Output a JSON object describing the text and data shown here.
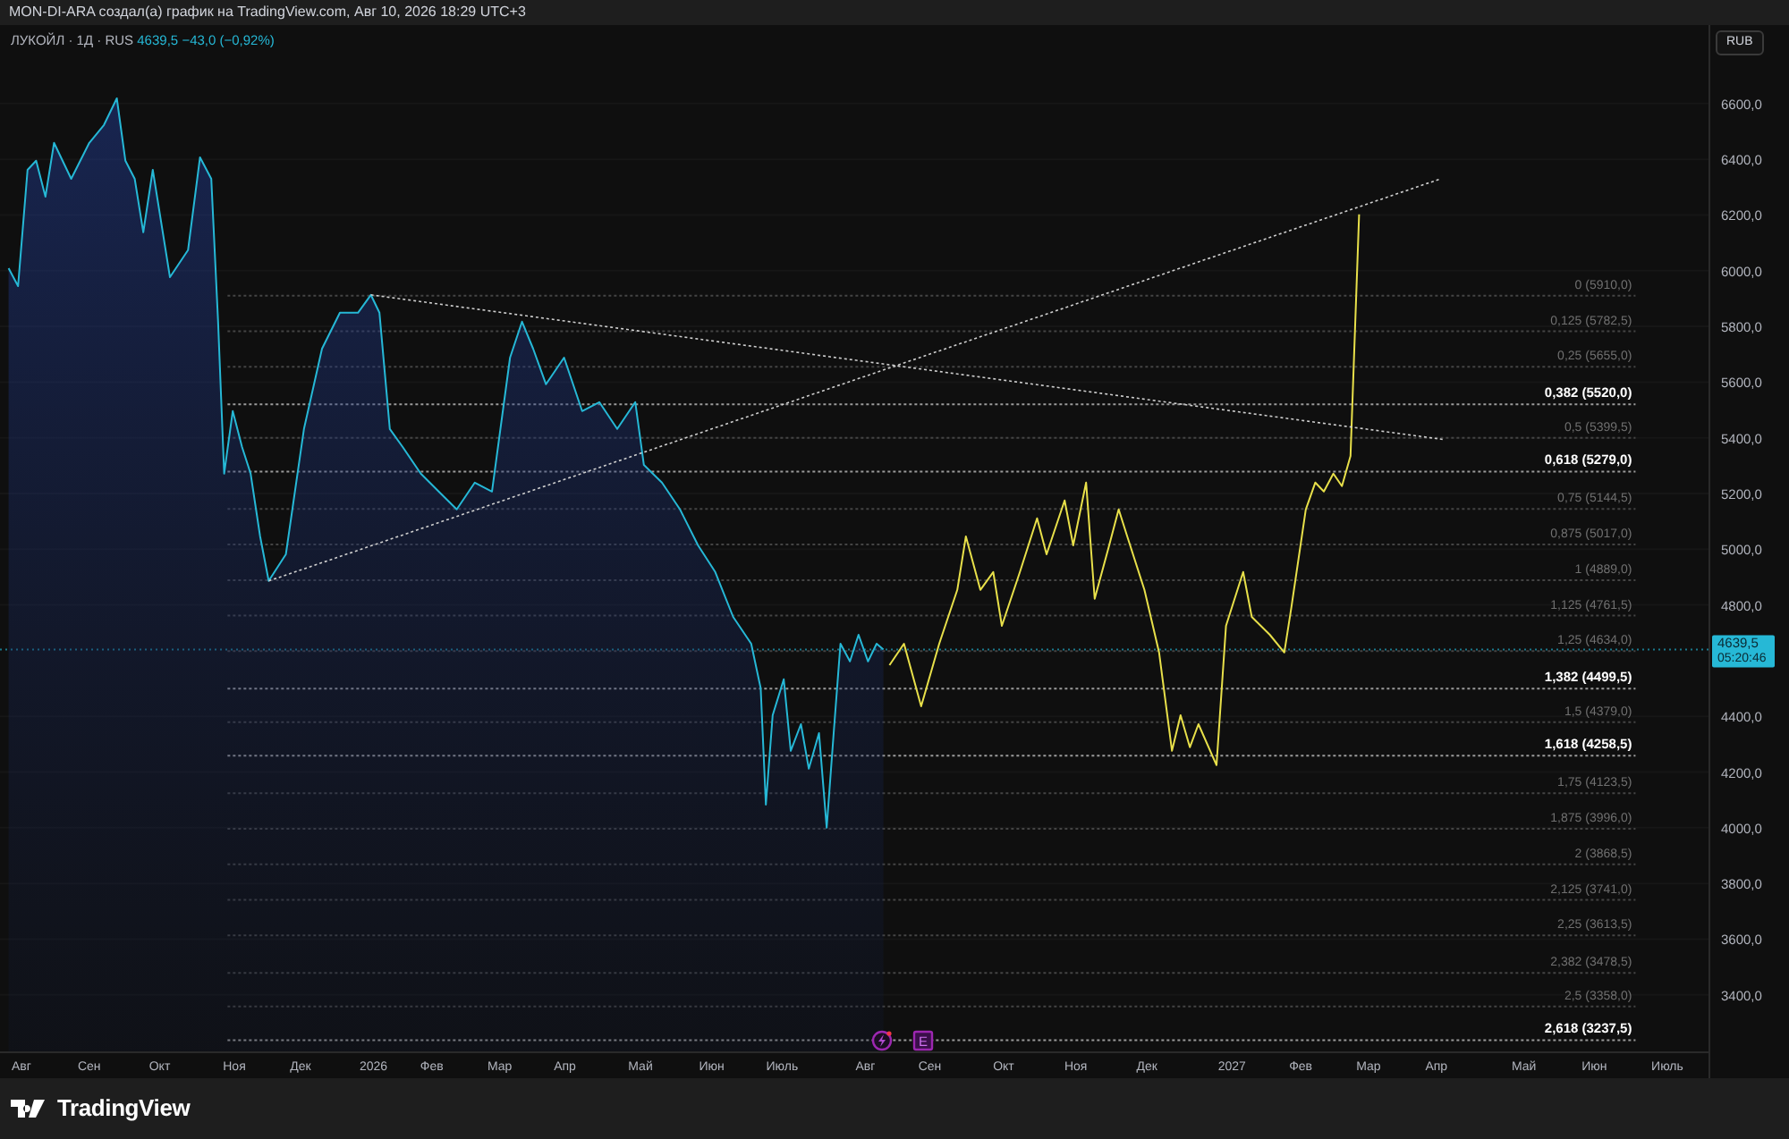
{
  "header": {
    "text": "MON-DI-ARA создал(а) график на TradingView.com, Авг 10, 2026 18:29 UTC+3"
  },
  "legend": {
    "symbol": "ЛУКОЙЛ · 1Д · RUS",
    "price": "4639,5",
    "change": "−43,0 (−0,92%)"
  },
  "currency_button": "RUB",
  "price_badge": {
    "price": "4639,5",
    "countdown": "05:20:46"
  },
  "events": [
    {
      "kind": "dividend"
    },
    {
      "kind": "earnings",
      "label": "E"
    }
  ],
  "chart_data": {
    "type": "line",
    "xlim": [
      2025.565,
      2027.555
    ],
    "ylim": [
      3197,
      6882
    ],
    "yticks": [
      {
        "value": 3400,
        "label": "3400,0"
      },
      {
        "value": 3600,
        "label": "3600,0"
      },
      {
        "value": 3800,
        "label": "3800,0"
      },
      {
        "value": 4000,
        "label": "4000,0"
      },
      {
        "value": 4200,
        "label": "4200,0"
      },
      {
        "value": 4400,
        "label": "4400,0"
      },
      {
        "value": 4800,
        "label": "4800,0"
      },
      {
        "value": 5000,
        "label": "5000,0"
      },
      {
        "value": 5200,
        "label": "5200,0"
      },
      {
        "value": 5400,
        "label": "5400,0"
      },
      {
        "value": 5600,
        "label": "5600,0"
      },
      {
        "value": 5800,
        "label": "5800,0"
      },
      {
        "value": 6000,
        "label": "6000,0"
      },
      {
        "value": 6200,
        "label": "6200,0"
      },
      {
        "value": 6400,
        "label": "6400,0"
      },
      {
        "value": 6600,
        "label": "6600,0"
      }
    ],
    "xticks": [
      {
        "value": 2025.59,
        "label": "Авг"
      },
      {
        "value": 2025.669,
        "label": "Сен"
      },
      {
        "value": 2025.751,
        "label": "Окт"
      },
      {
        "value": 2025.838,
        "label": "Ноя"
      },
      {
        "value": 2025.915,
        "label": "Дек"
      },
      {
        "value": 2026,
        "label": "2026"
      },
      {
        "value": 2026.068,
        "label": "Фев"
      },
      {
        "value": 2026.147,
        "label": "Мар"
      },
      {
        "value": 2026.223,
        "label": "Апр"
      },
      {
        "value": 2026.311,
        "label": "Май"
      },
      {
        "value": 2026.394,
        "label": "Июн"
      },
      {
        "value": 2026.476,
        "label": "Июль"
      },
      {
        "value": 2026.573,
        "label": "Авг"
      },
      {
        "value": 2026.648,
        "label": "Сен"
      },
      {
        "value": 2026.734,
        "label": "Окт"
      },
      {
        "value": 2026.818,
        "label": "Ноя"
      },
      {
        "value": 2026.901,
        "label": "Дек"
      },
      {
        "value": 2027,
        "label": "2027"
      },
      {
        "value": 2027.08,
        "label": "Фев"
      },
      {
        "value": 2027.159,
        "label": "Мар"
      },
      {
        "value": 2027.238,
        "label": "Апр"
      },
      {
        "value": 2027.34,
        "label": "Май"
      },
      {
        "value": 2027.422,
        "label": "Июн"
      },
      {
        "value": 2027.507,
        "label": "Июль"
      }
    ],
    "series": [
      {
        "color": "#26b8d6",
        "x": [
          2025.575,
          2025.586,
          2025.597,
          2025.607,
          2025.618,
          2025.628,
          2025.648,
          2025.669,
          2025.686,
          2025.701,
          2025.711,
          2025.722,
          2025.732,
          2025.743,
          2025.763,
          2025.784,
          2025.798,
          2025.811,
          2025.819,
          2025.826,
          2025.836,
          2025.847,
          2025.857,
          2025.868,
          2025.878,
          2025.898,
          2025.919,
          2025.94,
          2025.961,
          2025.982,
          2025.997,
          2026.007,
          2026.019,
          2026.034,
          2026.055,
          2026.076,
          2026.097,
          2026.118,
          2026.138,
          2026.159,
          2026.173,
          2026.186,
          2026.201,
          2026.222,
          2026.243,
          2026.263,
          2026.284,
          2026.305,
          2026.315,
          2026.336,
          2026.357,
          2026.378,
          2026.398,
          2026.419,
          2026.44,
          2026.451,
          2026.457,
          2026.465,
          2026.478,
          2026.486,
          2026.498,
          2026.507,
          2026.519,
          2026.528,
          2026.536,
          2026.544,
          2026.555,
          2026.565,
          2026.576,
          2026.586,
          2026.594
        ],
        "values": [
          6009,
          5945,
          6362,
          6395,
          6266,
          6459,
          6330,
          6459,
          6523,
          6619,
          6395,
          6330,
          6138,
          6362,
          5977,
          6074,
          6407,
          6330,
          5817,
          5271,
          5496,
          5367,
          5271,
          5046,
          4886,
          4982,
          5432,
          5720,
          5849,
          5849,
          5913,
          5849,
          5432,
          5367,
          5271,
          5207,
          5143,
          5239,
          5207,
          5688,
          5817,
          5720,
          5592,
          5688,
          5496,
          5528,
          5432,
          5528,
          5303,
          5239,
          5143,
          5014,
          4918,
          4757,
          4661,
          4501,
          4083,
          4404,
          4533,
          4276,
          4372,
          4212,
          4340,
          4000,
          4340,
          4661,
          4597,
          4693,
          4597,
          4661,
          4640
        ]
      },
      {
        "color": "#e8e04a",
        "x": [
          2026.601,
          2026.618,
          2026.638,
          2026.659,
          2026.68,
          2026.69,
          2026.707,
          2026.722,
          2026.732,
          2026.753,
          2026.773,
          2026.784,
          2026.805,
          2026.815,
          2026.83,
          2026.84,
          2026.857,
          2026.868,
          2026.878,
          2026.898,
          2026.915,
          2026.93,
          2026.94,
          2026.951,
          2026.961,
          2026.982,
          2026.993,
          2027.013,
          2027.023,
          2027.044,
          2027.061,
          2027.069,
          2027.086,
          2027.097,
          2027.107,
          2027.118,
          2027.128,
          2027.138,
          2027.148
        ],
        "values": [
          4584,
          4661,
          4436,
          4661,
          4854,
          5046,
          4854,
          4918,
          4725,
          4918,
          5111,
          4982,
          5175,
          5014,
          5239,
          4822,
          5014,
          5143,
          5046,
          4854,
          4629,
          4276,
          4404,
          4289,
          4372,
          4225,
          4725,
          4918,
          4757,
          4693,
          4629,
          4790,
          5143,
          5239,
          5207,
          5271,
          5226,
          5335,
          6202
        ]
      },
      {
        "color": "#cfcfcf",
        "line_style": "dashed",
        "x": [
          2025.997,
          2027.248
        ],
        "values": [
          5913,
          5393
        ]
      },
      {
        "color": "#cfcfcf",
        "line_style": "dashed",
        "x": [
          2025.878,
          2027.243
        ],
        "values": [
          4886,
          6330
        ]
      }
    ],
    "grid": true,
    "ref_lines": [
      {
        "axis": "y",
        "value": 4640,
        "color": "#1a7a8e"
      },
      {
        "axis": "y",
        "value": 5910,
        "label": "0 (5910,0)",
        "color": "#444444"
      },
      {
        "axis": "y",
        "value": 5782.5,
        "label": "0,125 (5782,5)",
        "color": "#444444"
      },
      {
        "axis": "y",
        "value": 5655,
        "label": "0,25 (5655,0)",
        "color": "#444444"
      },
      {
        "axis": "y",
        "value": 5520,
        "label": "0,382 (5520,0)",
        "color": "#9a9a9a"
      },
      {
        "axis": "y",
        "value": 5399.5,
        "label": "0,5 (5399,5)",
        "color": "#444444"
      },
      {
        "axis": "y",
        "value": 5279,
        "label": "0,618 (5279,0)",
        "color": "#9a9a9a"
      },
      {
        "axis": "y",
        "value": 5144.5,
        "label": "0,75 (5144,5)",
        "color": "#444444"
      },
      {
        "axis": "y",
        "value": 5017,
        "label": "0,875 (5017,0)",
        "color": "#444444"
      },
      {
        "axis": "y",
        "value": 4889,
        "label": "1 (4889,0)",
        "color": "#444444"
      },
      {
        "axis": "y",
        "value": 4761.5,
        "label": "1,125 (4761,5)",
        "color": "#444444"
      },
      {
        "axis": "y",
        "value": 4634,
        "label": "1,25 (4634,0)",
        "color": "#444444"
      },
      {
        "axis": "y",
        "value": 4499.5,
        "label": "1,382 (4499,5)",
        "color": "#9a9a9a"
      },
      {
        "axis": "y",
        "value": 4379,
        "label": "1,5 (4379,0)",
        "color": "#444444"
      },
      {
        "axis": "y",
        "value": 4258.5,
        "label": "1,618 (4258,5)",
        "color": "#9a9a9a"
      },
      {
        "axis": "y",
        "value": 4123.5,
        "label": "1,75 (4123,5)",
        "color": "#444444"
      },
      {
        "axis": "y",
        "value": 3996,
        "label": "1,875 (3996,0)",
        "color": "#444444"
      },
      {
        "axis": "y",
        "value": 3868.5,
        "label": "2 (3868,5)",
        "color": "#444444"
      },
      {
        "axis": "y",
        "value": 3741,
        "label": "2,125 (3741,0)",
        "color": "#444444"
      },
      {
        "axis": "y",
        "value": 3613.5,
        "label": "2,25 (3613,5)",
        "color": "#444444"
      },
      {
        "axis": "y",
        "value": 3478.5,
        "label": "2,382 (3478,5)",
        "color": "#444444"
      },
      {
        "axis": "y",
        "value": 3358,
        "label": "2,5 (3358,0)",
        "color": "#444444"
      },
      {
        "axis": "y",
        "value": 3237.5,
        "label": "2,618 (3237,5)",
        "color": "#9a9a9a"
      }
    ]
  },
  "footer": {
    "brand": "TradingView"
  }
}
